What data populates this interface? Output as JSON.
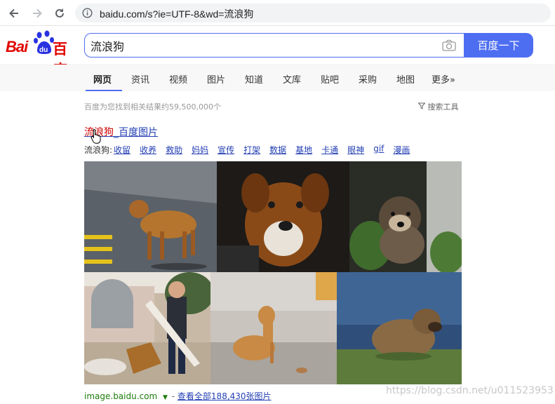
{
  "browser": {
    "url": "baidu.com/s?ie=UTF-8&wd=流浪狗"
  },
  "logo": {
    "bai": "Bai",
    "du": "du",
    "baidu_cn": "百度"
  },
  "search": {
    "query": "流浪狗",
    "button_label": "百度一下"
  },
  "tabs": [
    {
      "label": "网页",
      "active": true
    },
    {
      "label": "资讯"
    },
    {
      "label": "视频"
    },
    {
      "label": "图片"
    },
    {
      "label": "知道"
    },
    {
      "label": "文库"
    },
    {
      "label": "贴吧"
    },
    {
      "label": "采购"
    },
    {
      "label": "地图"
    },
    {
      "label": "更多»"
    }
  ],
  "results": {
    "count_text": "百度为您找到相关结果约59,500,000个",
    "tools_label": "搜索工具",
    "image_result": {
      "title_keyword": "流浪狗",
      "title_rest": "_百度图片",
      "chip_label": "流浪狗:",
      "chips": [
        "收留",
        "收养",
        "救助",
        "妈妈",
        "宣传",
        "打架",
        "数据",
        "基地",
        "卡通",
        "眼神",
        "gif",
        "漫画"
      ],
      "source": "image.baidu.com",
      "separator": "-",
      "view_all": "查看全部188,430张图片"
    }
  },
  "watermark": "https://blog.csdn.net/u011523953",
  "colors": {
    "accent": "#4e6ef2",
    "link": "#2440b3",
    "keyword": "#c00000",
    "brand_red": "#e10601",
    "source_green": "#1e7d0c"
  }
}
